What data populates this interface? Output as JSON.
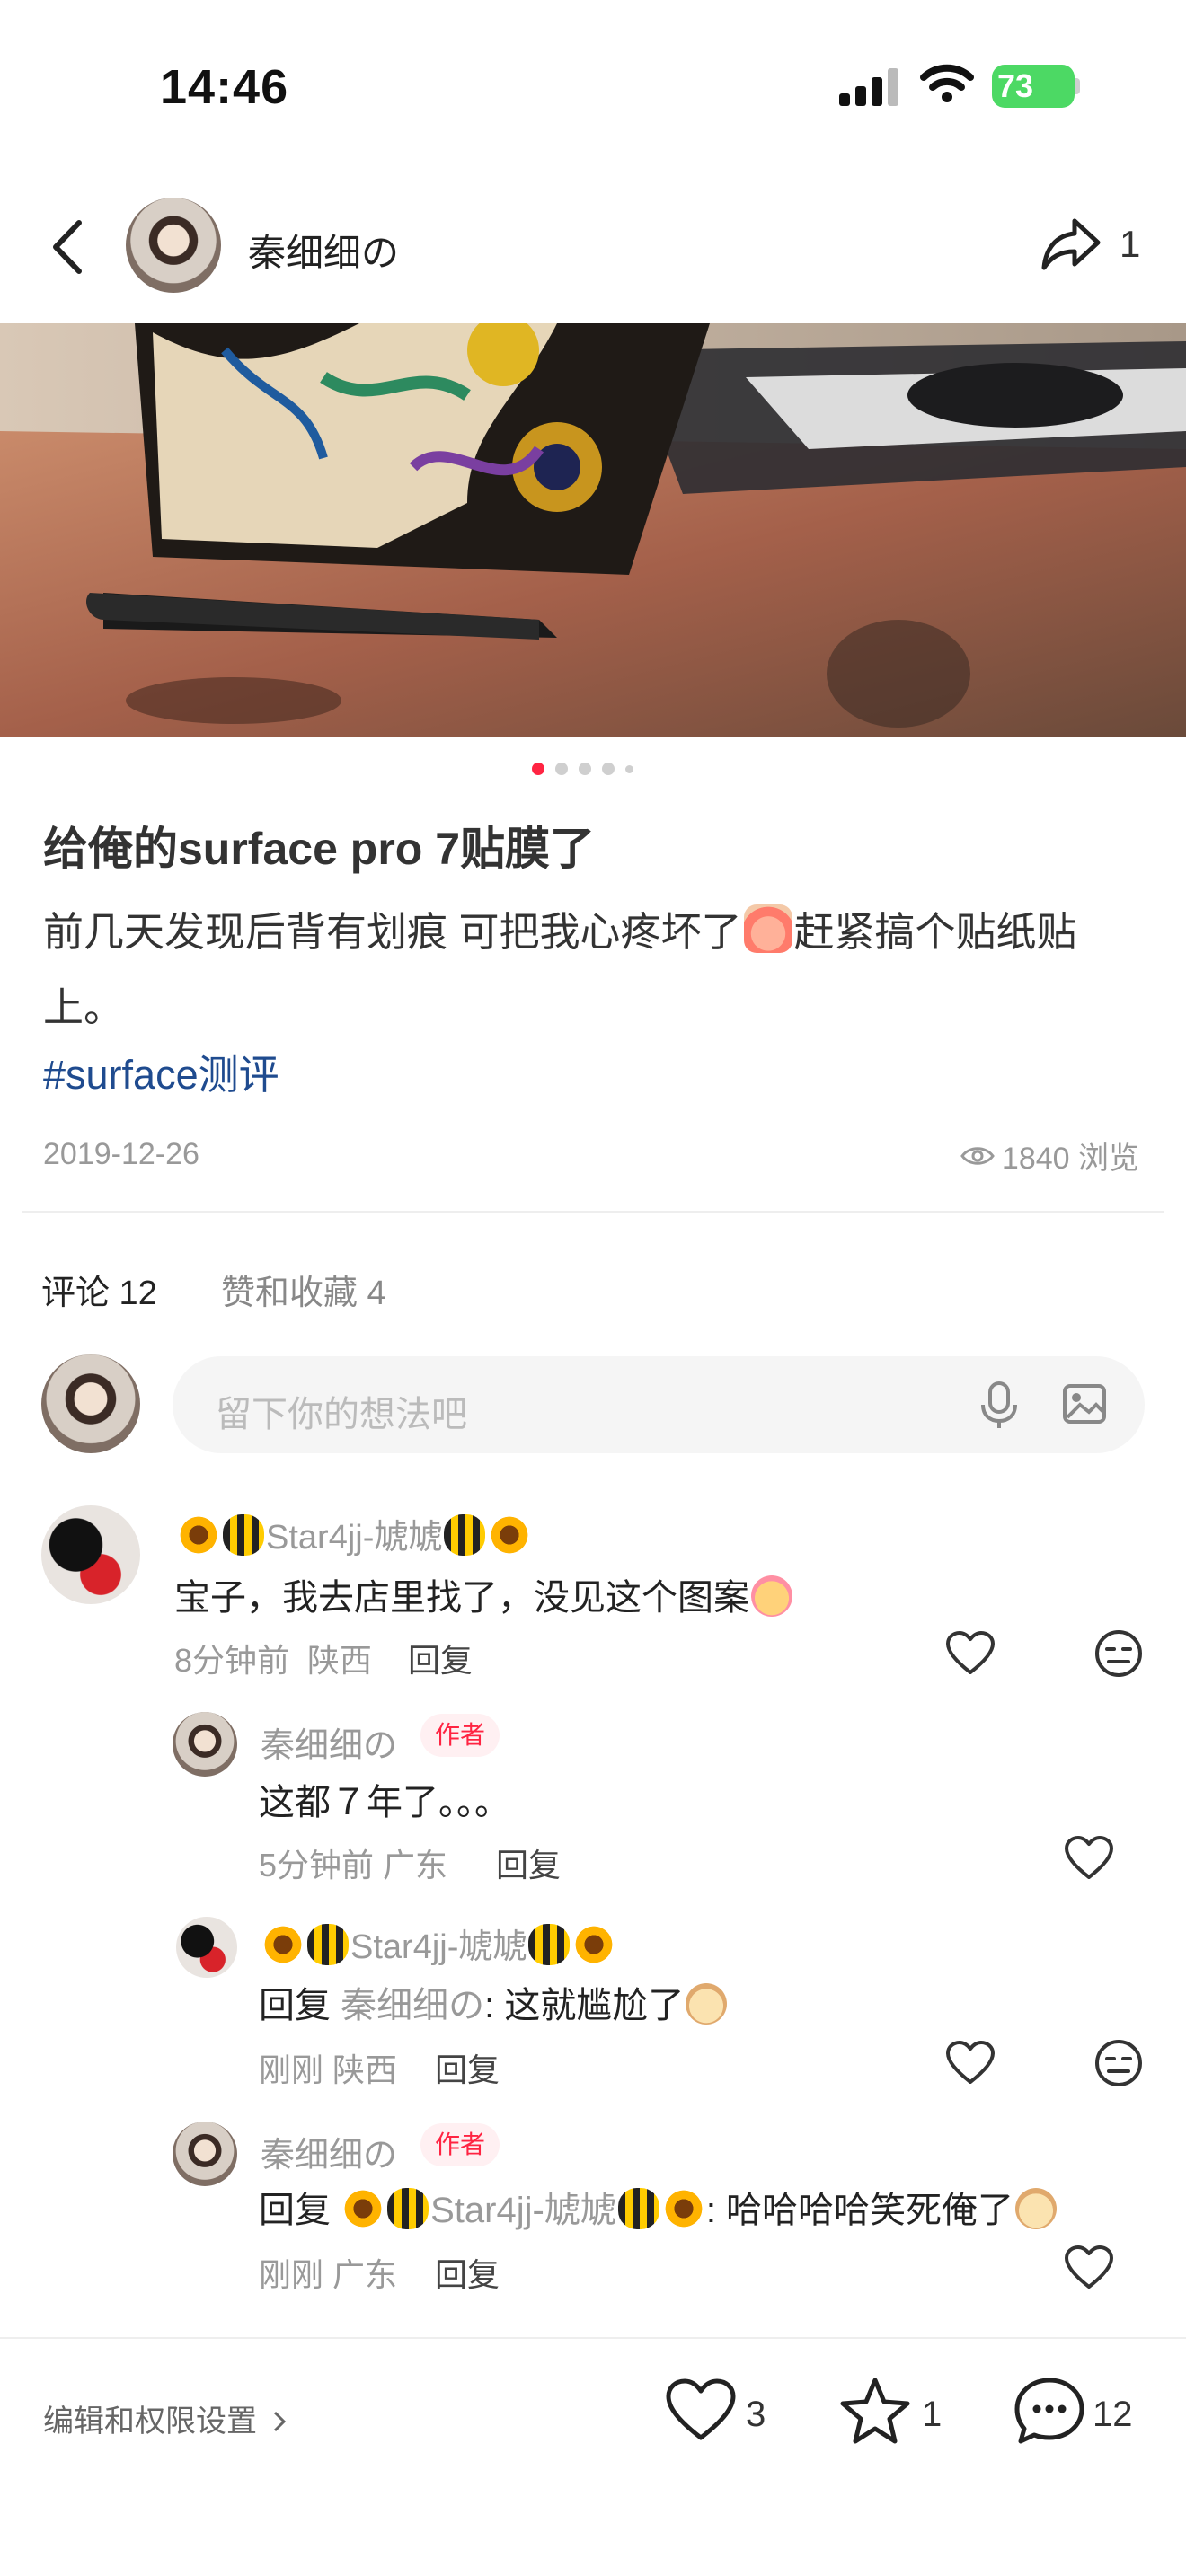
{
  "status_bar": {
    "time": "14:46",
    "battery": "73"
  },
  "header": {
    "author_name": "秦细细の",
    "share_count": "1"
  },
  "carousel": {
    "total": 5,
    "active_index": 0
  },
  "post": {
    "title": "给俺的surface pro 7贴膜了",
    "body_before_emoji": "前几天发现后背有划痕 可把我心疼坏了",
    "body_after_emoji": "赶紧搞个贴纸贴上。",
    "hashtag": "#surface测评",
    "date": "2019-12-26",
    "views": "1840 浏览"
  },
  "tabs": {
    "comments": "评论 12",
    "likes": "赞和收藏 4"
  },
  "comment_input": {
    "placeholder": "留下你的想法吧"
  },
  "comments": [
    {
      "name": "Star4jj-虓虓",
      "text": "宝子，我去店里找了，没见这个图案",
      "time": "8分钟前",
      "location": "陕西",
      "reply_label": "回复"
    },
    {
      "name": "秦细细の",
      "badge": "作者",
      "text": "这都７年了。。。",
      "time": "5分钟前",
      "location": "广东",
      "reply_label": "回复"
    },
    {
      "name": "Star4jj-虓虓",
      "text_prefix": "回复",
      "reply_to": "秦细细の",
      "text": ": 这就尴尬了",
      "time": "刚刚",
      "location": "陕西",
      "reply_label": "回复"
    },
    {
      "name": "秦细细の",
      "badge": "作者",
      "text_prefix": "回复",
      "reply_to": "Star4jj-虓虓",
      "text": ": 哈哈哈哈笑死俺了",
      "time": "刚刚",
      "location": "广东",
      "reply_label": "回复"
    }
  ],
  "bottom_bar": {
    "edit_label": "编辑和权限设置",
    "like_count": "3",
    "star_count": "1",
    "comment_count": "12"
  },
  "colors": {
    "accent": "#ff2442",
    "hashtag": "#1f4b8f",
    "battery": "#4cd964"
  }
}
